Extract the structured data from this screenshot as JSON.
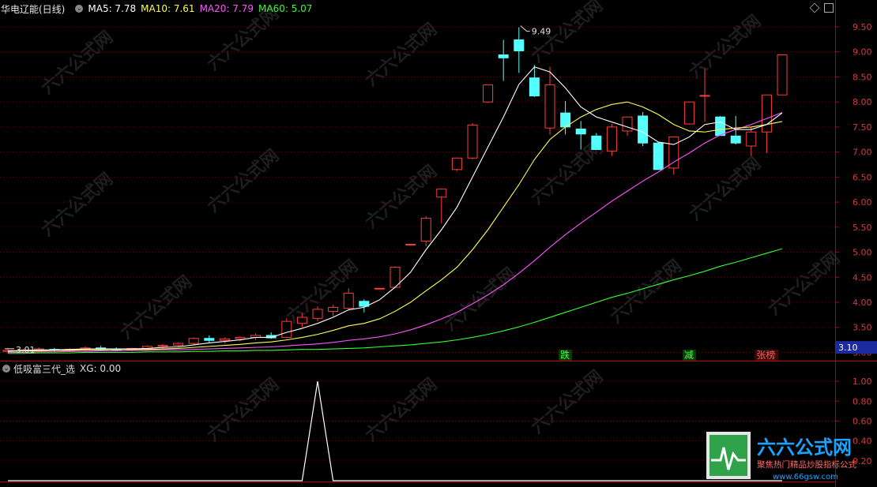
{
  "title": {
    "stock": "华电辽能(日线)",
    "ma5": "MA5: 7.78",
    "ma10": "MA10: 7.61",
    "ma20": "MA20: 7.79",
    "ma60": "MA60: 5.07"
  },
  "indicator": {
    "name": "低吸富三代_选",
    "value": "XG: 0.00",
    "y_ticks": [
      "1.00",
      "0.80",
      "0.60",
      "0.40",
      "0.20"
    ]
  },
  "price_axis": [
    "9.50",
    "9.00",
    "8.50",
    "8.00",
    "7.50",
    "7.00",
    "6.50",
    "6.00",
    "5.50",
    "5.00",
    "4.50",
    "4.00",
    "3.50",
    "3.00"
  ],
  "current_price": "3.10",
  "annotations": {
    "high": "9.49",
    "low": "3.01",
    "die": "跌",
    "jian": "减",
    "zhangbang": "张榜"
  },
  "watermark": "六六公式网",
  "logo": {
    "name": "六六公式网",
    "slogan": "聚焦热门精品炒股指标公式",
    "url": "www.66gsw.com"
  },
  "colors": {
    "up": "#ff3c3c",
    "down": "#54ffff",
    "ma5": "#ffffff",
    "ma10": "#ffff55",
    "ma20": "#ff55ff",
    "ma60": "#33ff33",
    "axis": "#b40000"
  },
  "chart_data": {
    "type": "candlestick",
    "ylim": [
      2.85,
      9.72
    ],
    "candles": [
      {
        "o": 3.02,
        "h": 3.09,
        "l": 2.98,
        "c": 3.04
      },
      {
        "o": 3.03,
        "h": 3.07,
        "l": 3.0,
        "c": 3.05
      },
      {
        "o": 3.05,
        "h": 3.1,
        "l": 3.02,
        "c": 3.07
      },
      {
        "o": 3.06,
        "h": 3.09,
        "l": 3.02,
        "c": 3.04
      },
      {
        "o": 3.04,
        "h": 3.08,
        "l": 3.01,
        "c": 3.06
      },
      {
        "o": 3.06,
        "h": 3.12,
        "l": 3.03,
        "c": 3.09
      },
      {
        "o": 3.09,
        "h": 3.13,
        "l": 3.05,
        "c": 3.07
      },
      {
        "o": 3.07,
        "h": 3.1,
        "l": 3.03,
        "c": 3.05
      },
      {
        "o": 3.05,
        "h": 3.09,
        "l": 3.02,
        "c": 3.08
      },
      {
        "o": 3.08,
        "h": 3.14,
        "l": 3.05,
        "c": 3.12
      },
      {
        "o": 3.12,
        "h": 3.17,
        "l": 3.08,
        "c": 3.14
      },
      {
        "o": 3.14,
        "h": 3.2,
        "l": 3.1,
        "c": 3.18
      },
      {
        "o": 3.18,
        "h": 3.3,
        "l": 3.15,
        "c": 3.28
      },
      {
        "o": 3.28,
        "h": 3.34,
        "l": 3.2,
        "c": 3.24
      },
      {
        "o": 3.24,
        "h": 3.3,
        "l": 3.18,
        "c": 3.27
      },
      {
        "o": 3.27,
        "h": 3.32,
        "l": 3.22,
        "c": 3.3
      },
      {
        "o": 3.3,
        "h": 3.38,
        "l": 3.25,
        "c": 3.34
      },
      {
        "o": 3.34,
        "h": 3.4,
        "l": 3.27,
        "c": 3.29
      },
      {
        "o": 3.3,
        "h": 3.68,
        "l": 3.28,
        "c": 3.62
      },
      {
        "o": 3.58,
        "h": 3.78,
        "l": 3.5,
        "c": 3.7
      },
      {
        "o": 3.68,
        "h": 3.92,
        "l": 3.62,
        "c": 3.86
      },
      {
        "o": 3.82,
        "h": 3.95,
        "l": 3.72,
        "c": 3.9
      },
      {
        "o": 3.88,
        "h": 4.28,
        "l": 3.85,
        "c": 4.18
      },
      {
        "o": 4.02,
        "h": 4.06,
        "l": 3.8,
        "c": 3.92
      },
      {
        "o": 4.28,
        "h": 4.28,
        "l": 4.28,
        "c": 4.28
      },
      {
        "o": 4.3,
        "h": 4.72,
        "l": 4.28,
        "c": 4.7
      },
      {
        "o": 5.16,
        "h": 5.16,
        "l": 5.16,
        "c": 5.16
      },
      {
        "o": 5.22,
        "h": 5.72,
        "l": 5.12,
        "c": 5.68
      },
      {
        "o": 6.1,
        "h": 6.26,
        "l": 5.58,
        "c": 6.26
      },
      {
        "o": 6.65,
        "h": 6.88,
        "l": 6.62,
        "c": 6.88
      },
      {
        "o": 6.88,
        "h": 7.58,
        "l": 6.85,
        "c": 7.54
      },
      {
        "o": 8.0,
        "h": 8.34,
        "l": 7.98,
        "c": 8.34
      },
      {
        "o": 8.94,
        "h": 9.24,
        "l": 8.42,
        "c": 8.88
      },
      {
        "o": 9.24,
        "h": 9.49,
        "l": 8.58,
        "c": 9.02
      },
      {
        "o": 8.48,
        "h": 8.74,
        "l": 8.1,
        "c": 8.12
      },
      {
        "o": 7.48,
        "h": 8.7,
        "l": 7.35,
        "c": 8.34
      },
      {
        "o": 7.78,
        "h": 8.02,
        "l": 7.35,
        "c": 7.5
      },
      {
        "o": 7.46,
        "h": 7.62,
        "l": 7.05,
        "c": 7.36
      },
      {
        "o": 7.32,
        "h": 7.38,
        "l": 7.05,
        "c": 7.05
      },
      {
        "o": 7.02,
        "h": 7.56,
        "l": 6.92,
        "c": 7.5
      },
      {
        "o": 7.42,
        "h": 7.7,
        "l": 7.32,
        "c": 7.7
      },
      {
        "o": 7.72,
        "h": 7.8,
        "l": 7.12,
        "c": 7.18
      },
      {
        "o": 7.18,
        "h": 7.2,
        "l": 6.68,
        "c": 6.65
      },
      {
        "o": 6.68,
        "h": 7.3,
        "l": 6.55,
        "c": 7.3
      },
      {
        "o": 7.56,
        "h": 8.0,
        "l": 7.55,
        "c": 8.0
      },
      {
        "o": 8.13,
        "h": 8.66,
        "l": 7.6,
        "c": 8.13
      },
      {
        "o": 7.7,
        "h": 7.72,
        "l": 7.33,
        "c": 7.33
      },
      {
        "o": 7.32,
        "h": 7.72,
        "l": 7.15,
        "c": 7.18
      },
      {
        "o": 7.12,
        "h": 7.5,
        "l": 6.92,
        "c": 7.4
      },
      {
        "o": 7.4,
        "h": 7.92,
        "l": 6.98,
        "c": 8.14
      },
      {
        "o": 8.14,
        "h": 8.94,
        "l": 8.14,
        "c": 8.94
      }
    ],
    "ma5": [
      3.03,
      3.04,
      3.05,
      3.05,
      3.06,
      3.07,
      3.07,
      3.07,
      3.07,
      3.08,
      3.1,
      3.11,
      3.15,
      3.19,
      3.22,
      3.25,
      3.3,
      3.3,
      3.4,
      3.48,
      3.58,
      3.7,
      3.85,
      3.9,
      4.05,
      4.3,
      4.6,
      5.05,
      5.45,
      5.9,
      6.5,
      7.1,
      7.7,
      8.35,
      8.7,
      8.6,
      8.28,
      7.9,
      7.7,
      7.6,
      7.5,
      7.4,
      7.2,
      7.15,
      7.3,
      7.55,
      7.6,
      7.45,
      7.45,
      7.55,
      7.78
    ],
    "ma10": [
      3.02,
      3.03,
      3.03,
      3.04,
      3.04,
      3.05,
      3.05,
      3.06,
      3.06,
      3.06,
      3.07,
      3.08,
      3.1,
      3.12,
      3.14,
      3.16,
      3.19,
      3.21,
      3.25,
      3.3,
      3.36,
      3.44,
      3.53,
      3.58,
      3.67,
      3.82,
      4.0,
      4.23,
      4.45,
      4.7,
      5.05,
      5.45,
      5.9,
      6.35,
      6.85,
      7.25,
      7.5,
      7.7,
      7.85,
      7.95,
      8.0,
      7.9,
      7.75,
      7.55,
      7.42,
      7.4,
      7.45,
      7.48,
      7.5,
      7.55,
      7.61
    ],
    "ma20": [
      3.0,
      3.0,
      3.01,
      3.01,
      3.02,
      3.02,
      3.03,
      3.03,
      3.04,
      3.04,
      3.05,
      3.05,
      3.06,
      3.07,
      3.08,
      3.09,
      3.1,
      3.11,
      3.13,
      3.15,
      3.17,
      3.2,
      3.24,
      3.27,
      3.31,
      3.37,
      3.45,
      3.55,
      3.67,
      3.8,
      3.97,
      4.15,
      4.35,
      4.58,
      4.83,
      5.1,
      5.35,
      5.58,
      5.8,
      6.02,
      6.22,
      6.42,
      6.6,
      6.8,
      6.98,
      7.18,
      7.34,
      7.45,
      7.55,
      7.67,
      7.79
    ],
    "ma60": [
      2.98,
      2.98,
      2.99,
      2.99,
      2.99,
      3.0,
      3.0,
      3.0,
      3.0,
      3.01,
      3.01,
      3.01,
      3.02,
      3.02,
      3.03,
      3.03,
      3.04,
      3.04,
      3.05,
      3.06,
      3.06,
      3.07,
      3.08,
      3.09,
      3.11,
      3.13,
      3.15,
      3.18,
      3.21,
      3.25,
      3.3,
      3.36,
      3.43,
      3.51,
      3.6,
      3.7,
      3.8,
      3.9,
      4.0,
      4.1,
      4.18,
      4.27,
      4.36,
      4.45,
      4.53,
      4.62,
      4.72,
      4.8,
      4.89,
      4.98,
      5.07
    ],
    "indicator_xg": [
      0,
      0,
      0,
      0,
      0,
      0,
      0,
      0,
      0,
      0,
      0,
      0,
      0,
      0,
      0,
      0,
      0,
      0,
      0,
      0,
      1,
      0,
      0,
      0,
      0,
      0,
      0,
      0,
      0,
      0,
      0,
      0,
      0,
      0,
      0,
      0,
      0,
      0,
      0,
      0,
      0,
      0,
      0,
      0,
      0,
      0,
      0,
      0,
      0,
      0,
      0
    ]
  }
}
